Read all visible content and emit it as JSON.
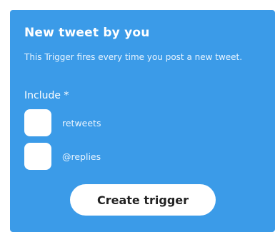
{
  "trigger": {
    "title": "New tweet by you",
    "description": "This Trigger fires every time you post a new tweet.",
    "include_label": "Include *",
    "options": [
      {
        "label": "retweets",
        "checked": false
      },
      {
        "label": "@replies",
        "checked": false
      }
    ],
    "create_button_label": "Create trigger"
  },
  "colors": {
    "card_background": "#3b9be8",
    "button_background": "#ffffff",
    "button_text": "#222222"
  }
}
